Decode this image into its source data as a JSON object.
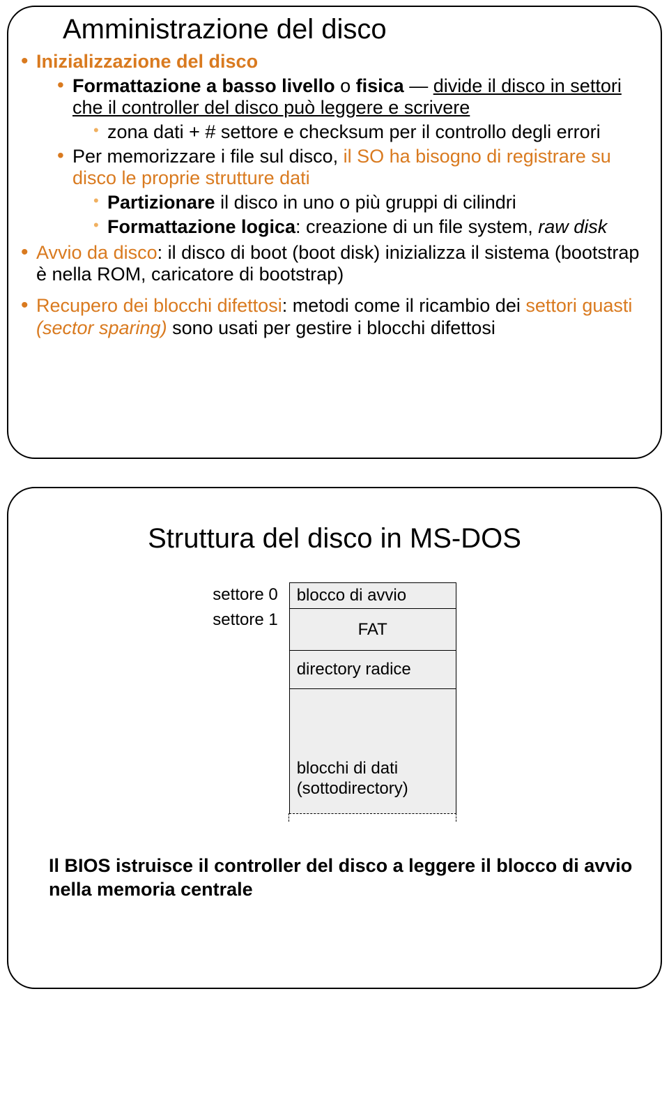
{
  "slide1": {
    "title": "Amministrazione del disco",
    "b1_lead": "Inizializzazione del disco",
    "b1a_pre": "Formattazione a basso livello",
    "b1a_mid1": " o ",
    "b1a_bold2": "fisica",
    "b1a_mid2": " — ",
    "b1a_rest": "divide il disco in settori che il controller del disco può leggere e scrivere",
    "b1a1": "zona dati + # settore e checksum per il controllo degli errori",
    "b1b_pre": "Per memorizzare i file sul disco, ",
    "b1b_orange": "il SO ha bisogno di registrare su disco le proprie strutture dati",
    "b1b1_lead": "Partizionare",
    "b1b1_rest": " il disco in uno o più gruppi di cilindri",
    "b1b2_lead": "Formattazione logica",
    "b1b2_rest": ": creazione di un file system, ",
    "b1b2_it": "raw disk",
    "b2_lead": "Avvio da disco",
    "b2_rest": ": il disco di boot (boot disk) inizializza il sistema (bootstrap è nella ROM, caricatore di bootstrap)",
    "b3_lead": "Recupero dei blocchi difettosi",
    "b3_mid1": ": metodi come il ricambio dei ",
    "b3_orange": "settori guasti ",
    "b3_it": "(sector sparing)",
    "b3_rest": " sono usati per gestire i blocchi difettosi"
  },
  "slide2": {
    "title": "Struttura del disco in MS-DOS",
    "sector0": "settore 0",
    "sector1": "settore 1",
    "cell_boot": "blocco di avvio",
    "cell_fat": "FAT",
    "cell_root": "directory radice",
    "cell_data_l1": "blocchi di dati",
    "cell_data_l2": "(sottodirectory)",
    "footer": "Il BIOS istruisce il controller del disco a leggere il blocco di avvio nella memoria centrale"
  }
}
